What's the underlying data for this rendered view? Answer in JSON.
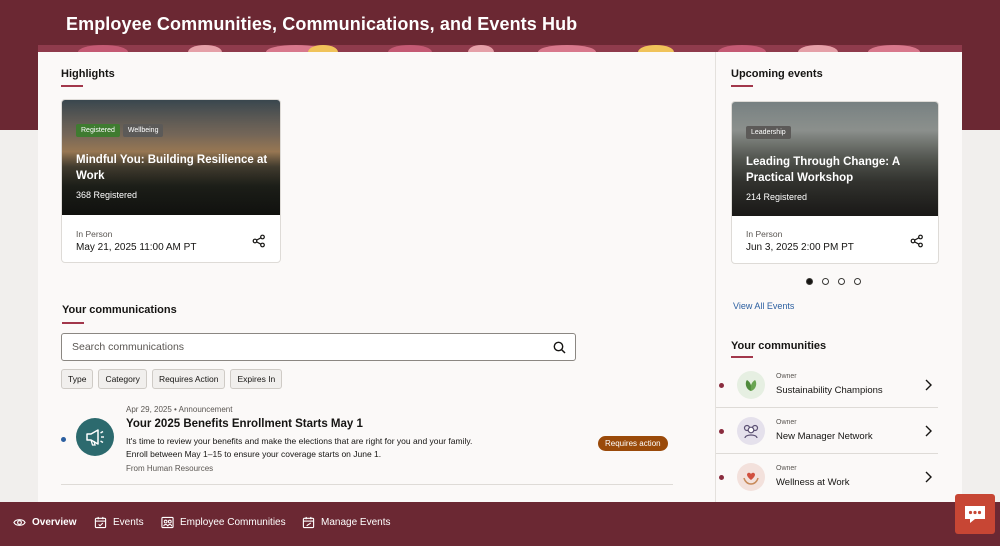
{
  "app": {
    "title": "Employee Communities, Communications, and Events Hub"
  },
  "highlights": {
    "title": "Highlights",
    "card": {
      "badges": [
        "Registered",
        "Wellbeing"
      ],
      "title": "Mindful You: Building Resilience at Work",
      "registered": "368 Registered",
      "mode": "In Person",
      "datetime": "May 21, 2025 11:00 AM PT"
    }
  },
  "upcoming": {
    "title": "Upcoming events",
    "card": {
      "badges": [
        "Leadership"
      ],
      "title": "Leading Through Change: A Practical Workshop",
      "registered": "214 Registered",
      "mode": "In Person",
      "datetime": "Jun 3, 2025 2:00 PM PT"
    },
    "pagination": {
      "pages": 4,
      "current": 1
    },
    "view_all": "View All Events"
  },
  "communications": {
    "title": "Your communications",
    "search_placeholder": "Search communications",
    "filters": [
      "Type",
      "Category",
      "Requires Action",
      "Expires In"
    ],
    "items": [
      {
        "date": "Apr 29, 2025",
        "type": "Announcement",
        "title": "Your 2025 Benefits Enrollment Starts May 1",
        "body_line1": "It's time to review your benefits and make the elections that are right for you and your family.",
        "body_line2": "Enroll between May 1–15 to ensure your coverage starts on June 1.",
        "from": "From Human Resources",
        "status": "Requires action"
      }
    ]
  },
  "communities": {
    "title": "Your communities",
    "items": [
      {
        "role": "Owner",
        "name": "Sustainability Champions",
        "icon": "leaf-icon",
        "color": "#e6efe2"
      },
      {
        "role": "Owner",
        "name": "New Manager Network",
        "icon": "people-icon",
        "color": "#e5e1ec"
      },
      {
        "role": "Owner",
        "name": "Wellness at Work",
        "icon": "heart-hands-icon",
        "color": "#f3e1dc"
      }
    ]
  },
  "nav": {
    "items": [
      {
        "label": "Overview",
        "icon": "eye-icon",
        "active": true
      },
      {
        "label": "Events",
        "icon": "calendar-icon",
        "active": false
      },
      {
        "label": "Employee Communities",
        "icon": "community-icon",
        "active": false
      },
      {
        "label": "Manage Events",
        "icon": "calendar-edit-icon",
        "active": false
      }
    ]
  },
  "colors": {
    "brand": "#6b2833",
    "accent": "#a2374b",
    "link": "#2b5fa0",
    "status_requires_action": "#9a4a0a",
    "chat": "#c74634"
  }
}
